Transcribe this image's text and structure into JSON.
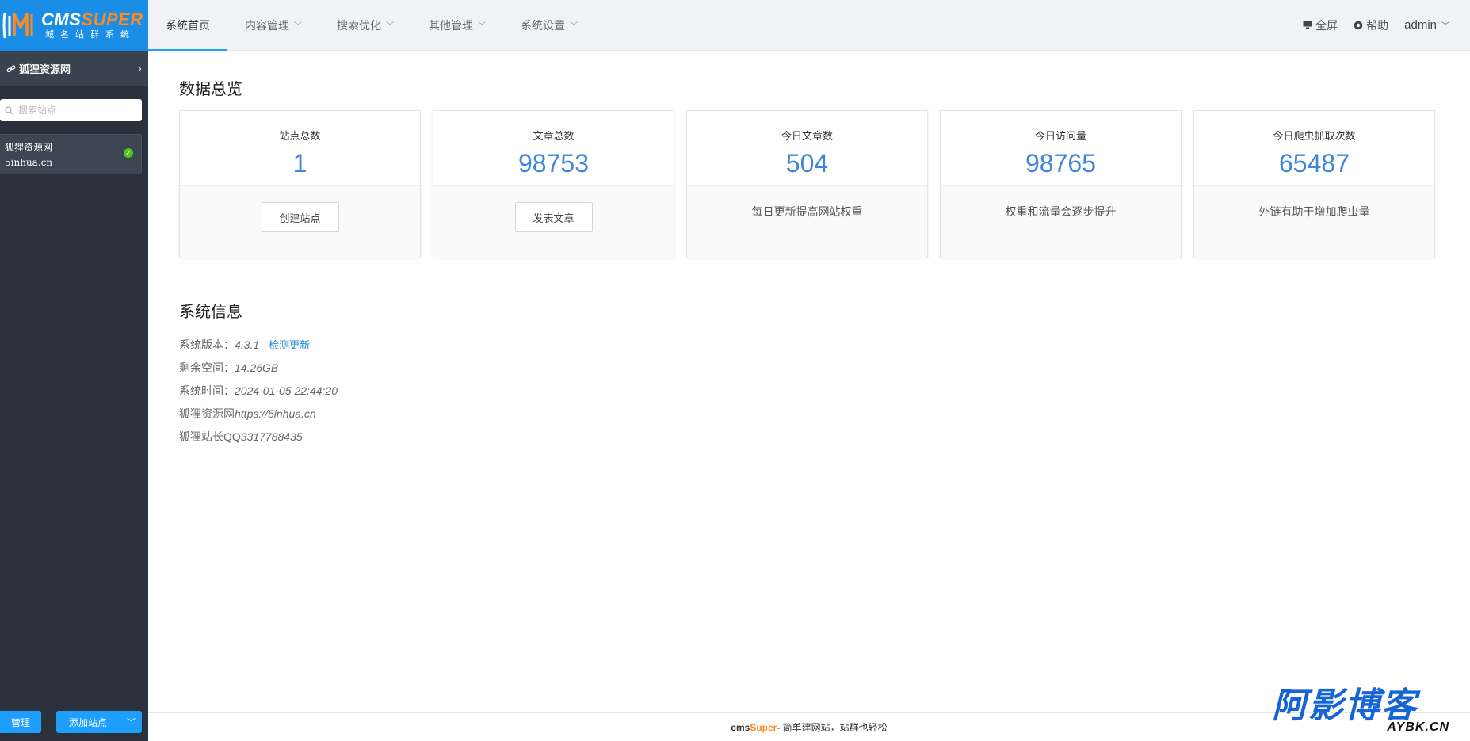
{
  "brand": {
    "logo_title_a": "CMS",
    "logo_title_b": "SUPER",
    "logo_subtitle": "城名站群系统",
    "primary_color": "#1e9fff",
    "accent_color": "#ff8a1f"
  },
  "sidebar": {
    "site_name": "狐狸资源网",
    "search_placeholder": "搜索站点",
    "sites": [
      {
        "name": "狐狸资源网",
        "domain": "5inhua.cn",
        "status": "ok"
      }
    ],
    "manage_label": "管理",
    "add_site_label": "添加站点"
  },
  "nav": {
    "items": [
      {
        "label": "系统首页",
        "active": true
      },
      {
        "label": "内容管理"
      },
      {
        "label": "搜索优化"
      },
      {
        "label": "其他管理"
      },
      {
        "label": "系统设置"
      }
    ],
    "fullscreen_label": "全屏",
    "help_label": "帮助",
    "user_label": "admin"
  },
  "overview": {
    "title": "数据总览",
    "stats": [
      {
        "label": "站点总数",
        "value": "1",
        "button": "创建站点"
      },
      {
        "label": "文章总数",
        "value": "98753",
        "button": "发表文章"
      },
      {
        "label": "今日文章数",
        "value": "504",
        "note": "每日更新提高网站权重"
      },
      {
        "label": "今日访问量",
        "value": "98765",
        "note": "权重和流量会逐步提升"
      },
      {
        "label": "今日爬虫抓取次数",
        "value": "65487",
        "note": "外链有助于增加爬虫量"
      }
    ]
  },
  "system": {
    "title": "系统信息",
    "version_label": "系统版本：",
    "version": "4.3.1",
    "check_update": "检测更新",
    "space_label": "剩余空间：",
    "space": "14.26GB",
    "time_label": "系统时间：",
    "time": "2024-01-05 22:44:20",
    "site_label": "狐狸资源网",
    "site_url": "https://5inhua.cn",
    "qq_label": "狐狸站长QQ",
    "qq": "3317788435"
  },
  "footer": {
    "brand_a": "cms",
    "brand_b": "Super",
    "slogan": " - 简单建网站，站群也轻松"
  },
  "watermark": {
    "big": "阿影博客",
    "small": "AYBK.CN"
  }
}
